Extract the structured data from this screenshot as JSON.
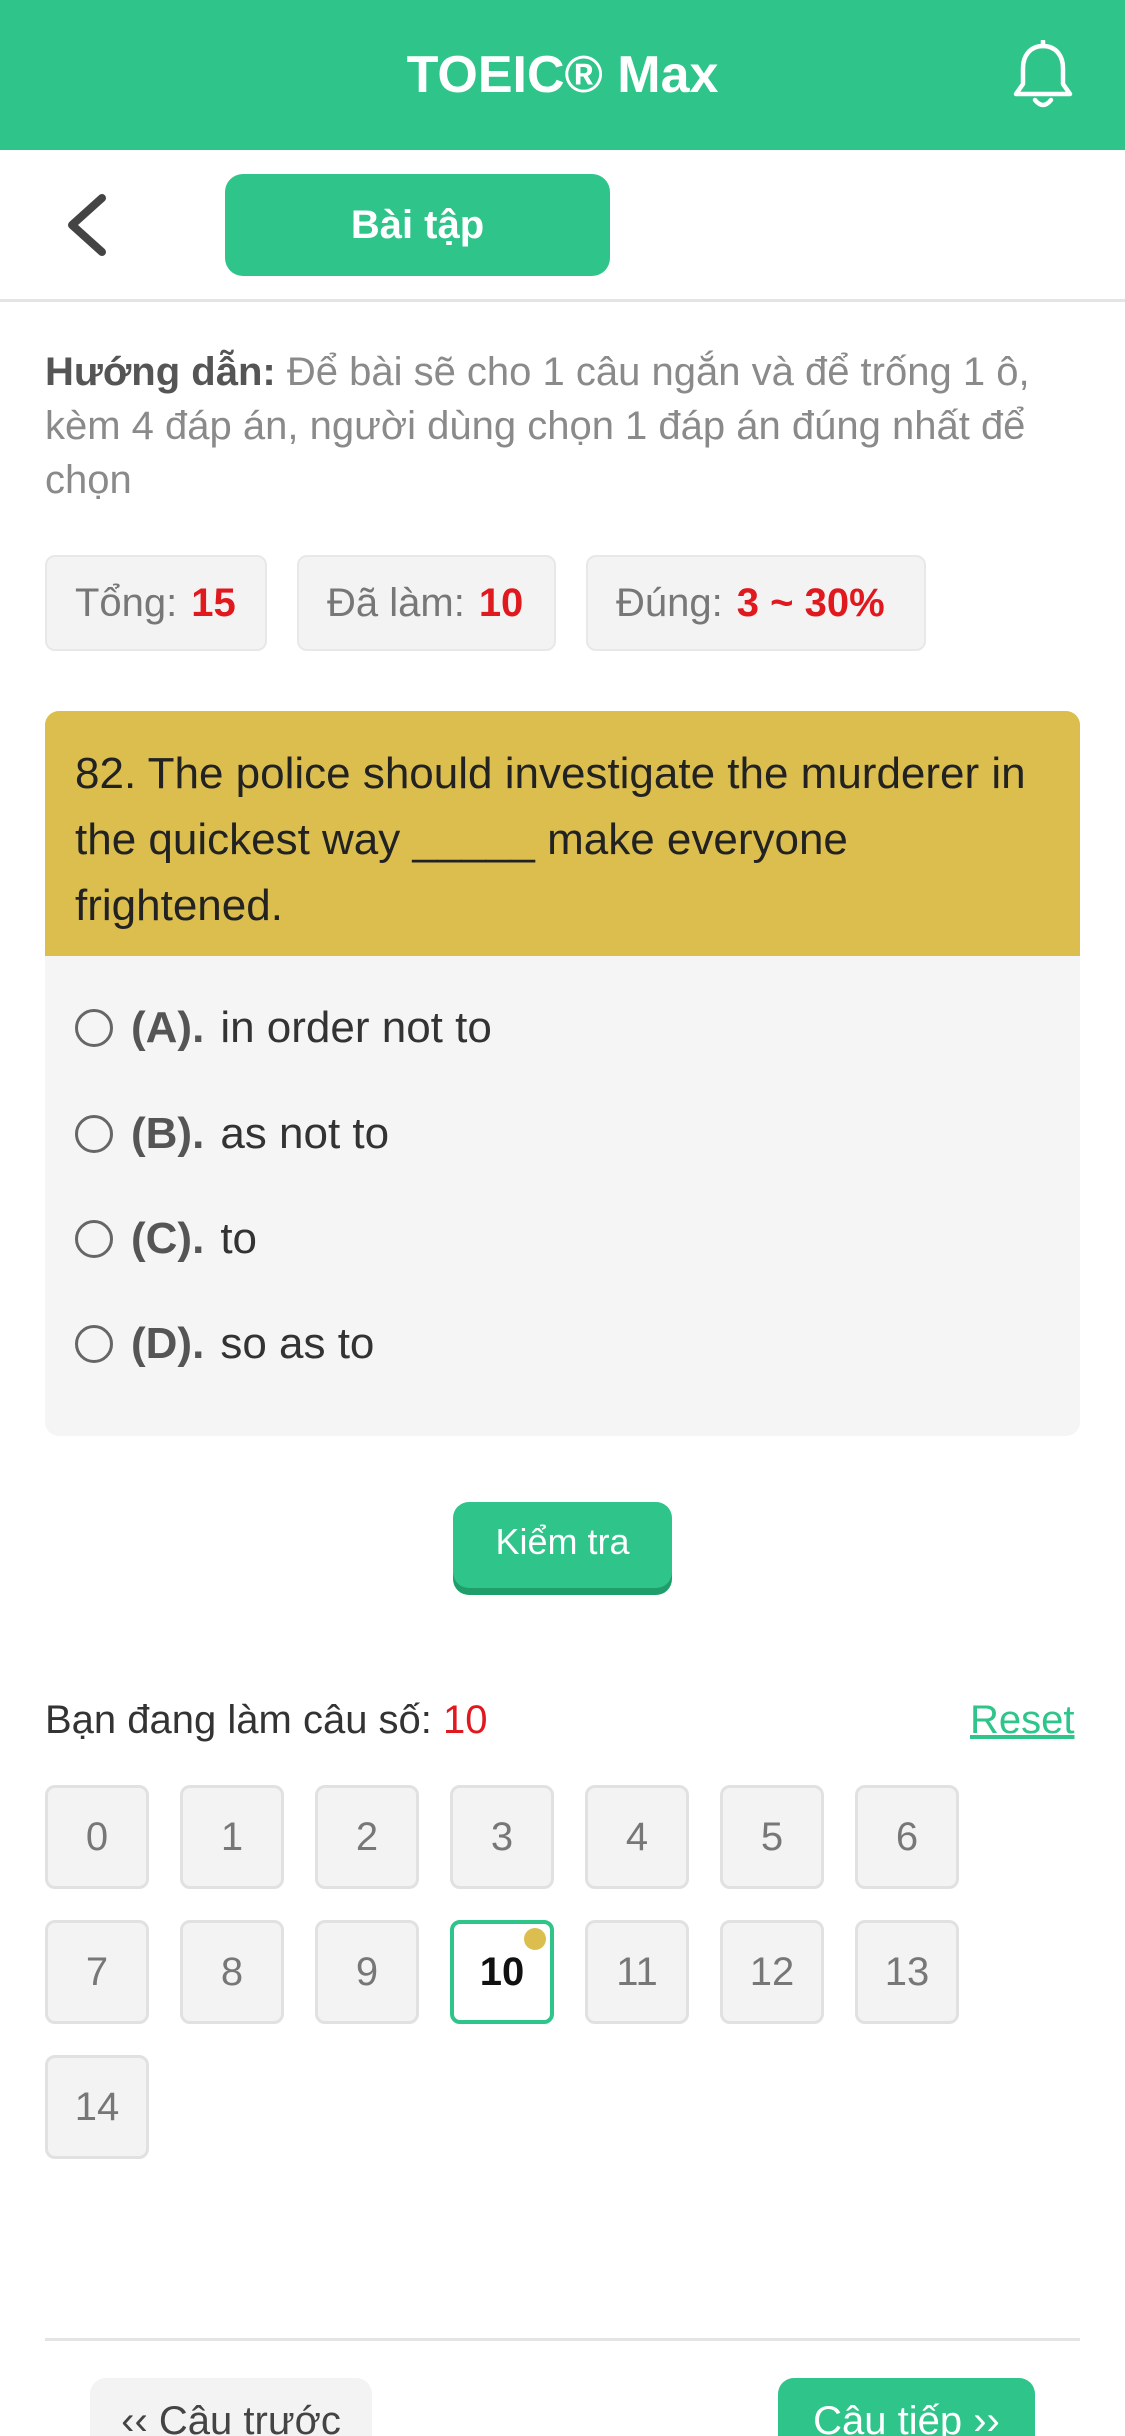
{
  "header": {
    "title": "TOEIC® Max",
    "bell_icon": "bell-icon"
  },
  "subheader": {
    "back_icon": "chevron-left-icon",
    "tab_label": "Bài tập"
  },
  "instructions": {
    "label": "Hướng dẫn:",
    "text": "Để bài sẽ cho 1 câu ngắn và để trống 1 ô, kèm 4 đáp án, người dùng chọn 1 đáp án đúng nhất để chọn"
  },
  "stats": {
    "total_label": "Tổng:",
    "total_value": "15",
    "done_label": "Đã làm:",
    "done_value": "10",
    "correct_label": "Đúng:",
    "correct_value": "3 ~ 30%"
  },
  "question": {
    "text": "82. The police should investigate the murderer in the quickest way _____ make everyone frightened.",
    "options": [
      {
        "letter": "(A).",
        "text": "in order not to"
      },
      {
        "letter": "(B).",
        "text": "as not to"
      },
      {
        "letter": "(C).",
        "text": "to"
      },
      {
        "letter": "(D).",
        "text": "so as to"
      }
    ]
  },
  "check_button": "Kiểm tra",
  "progress": {
    "label": "Bạn đang làm câu số:",
    "current": "10",
    "reset_label": "Reset"
  },
  "question_grid": [
    "0",
    "1",
    "2",
    "3",
    "4",
    "5",
    "6",
    "7",
    "8",
    "9",
    "10",
    "11",
    "12",
    "13",
    "14"
  ],
  "nav": {
    "prev_label": "‹‹ Câu trước",
    "next_label": "Câu tiếp ››"
  },
  "colors": {
    "primary": "#2ec48a",
    "question_bg": "#dbbe4e",
    "highlight": "#e0191f"
  }
}
